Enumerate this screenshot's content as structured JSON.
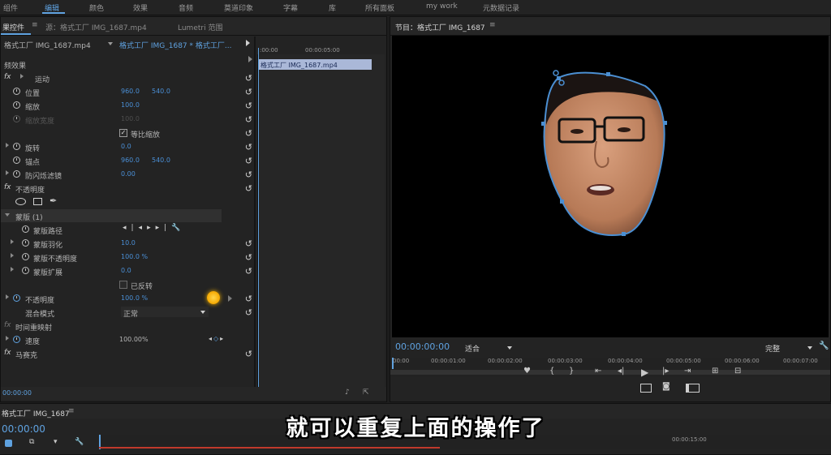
{
  "workspaces": [
    "组件",
    "编辑",
    "颜色",
    "效果",
    "音频",
    "莫道印象",
    "字幕",
    "库",
    "所有面板",
    "my work",
    "元数据记录"
  ],
  "effect_controls": {
    "tabs": [
      "果控件",
      "源：格式工厂 IMG_1687.mp4",
      "Lumetri 范围"
    ],
    "clip_source": "格式工厂 IMG_1687.mp4",
    "clip_target": "格式工厂 IMG_1687 * 格式工厂...",
    "section_label": "频效果",
    "motion": {
      "label": "运动",
      "position": {
        "label": "位置",
        "x": "960.0",
        "y": "540.0"
      },
      "scale": {
        "label": "缩放",
        "value": "100.0"
      },
      "scale_width": {
        "label": "缩放宽度",
        "value": "100.0"
      },
      "uniform_scale": "等比缩放",
      "rotation": {
        "label": "旋转",
        "value": "0.0"
      },
      "anchor": {
        "label": "锚点",
        "x": "960.0",
        "y": "540.0"
      },
      "anti_flicker": {
        "label": "防闪烁滤镜",
        "value": "0.00"
      }
    },
    "opacity_section": "不透明度",
    "mask": {
      "label": "蒙版 (1)",
      "path": "蒙版路径",
      "feather": {
        "label": "蒙版羽化",
        "value": "10.0"
      },
      "opacity": {
        "label": "蒙版不透明度",
        "value": "100.0 %"
      },
      "expansion": {
        "label": "蒙版扩展",
        "value": "0.0"
      },
      "inverted": "已反转"
    },
    "opacity": {
      "label": "不透明度",
      "value": "100.0 %"
    },
    "blend_mode": {
      "label": "混合模式",
      "value": "正常"
    },
    "time_remap": "时间重映射",
    "speed": {
      "label": "速度",
      "value": "100.00%"
    },
    "mosaic": "马赛克",
    "tl_ruler": [
      ":00:00",
      "00:00:05:00"
    ],
    "tl_clip": "格式工厂 IMG_1687.mp4",
    "bottom_timecode": "00:00:00"
  },
  "program": {
    "title": "节目：格式工厂 IMG_1687",
    "timecode": "00:00:00:00",
    "fit": "适合",
    "quality": "完整",
    "ruler": [
      "00:00",
      "00:00:01:00",
      "00:00:02:00",
      "00:00:03:00",
      "00:00:04:00",
      "00:00:05:00",
      "00:00:06:00",
      "00:00:07:00"
    ]
  },
  "timeline": {
    "tab": "格式工厂 IMG_1687",
    "timecode": "00:00:00",
    "ruler": [
      "00:00:15:00"
    ]
  },
  "caption": "就可以重复上面的操作了",
  "colors": {
    "accent": "#5fa2e0",
    "mask_path": "#4b8fd2",
    "cursor_highlight": "#f5b400"
  }
}
